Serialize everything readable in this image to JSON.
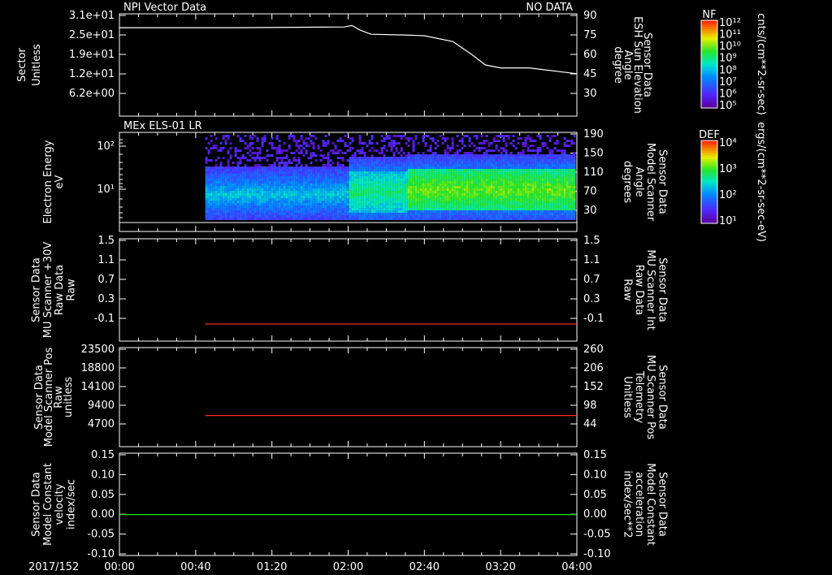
{
  "colors": {
    "axis": "#ffffff",
    "red": "#ff2a2a",
    "green": "#22dd22",
    "white": "#ffffff"
  },
  "time_axis": {
    "date_label": "2017/152",
    "ticks": [
      "00:00",
      "00:40",
      "01:20",
      "02:00",
      "02:40",
      "03:20",
      "04:00"
    ]
  },
  "colorbars": [
    {
      "label": "NF",
      "unit": "cnts/(cm**2-sr-sec)",
      "ticks": [
        "10¹²",
        "10¹¹",
        "10¹⁰",
        "10⁹",
        "10⁸",
        "10⁷",
        "10⁶",
        "10⁵"
      ]
    },
    {
      "label": "DEF",
      "unit": "ergs/(cm**2-sr-sec-eV)",
      "ticks": [
        "10⁴",
        "10³",
        "10²",
        "10¹"
      ]
    }
  ],
  "chart_data": [
    {
      "type": "line",
      "title": "NPI Vector Data",
      "status": "NO DATA",
      "ylabel_left": [
        "Sector",
        "Unitless"
      ],
      "left_ticks": [
        "3.1e+01",
        "2.5e+01",
        "1.9e+01",
        "1.2e+01",
        "6.2e+00"
      ],
      "ylabel_right": [
        "Sensor Data",
        "ESH Sun Elevation",
        "Angle",
        "degree"
      ],
      "right_ticks": [
        "90",
        "75",
        "60",
        "45",
        "30"
      ],
      "ylim": [
        20,
        90
      ],
      "series": [
        {
          "color": "#ffffff",
          "x": [
            0,
            60,
            118,
            122,
            126,
            132,
            150,
            160,
            175,
            185,
            192,
            200,
            215,
            240
          ],
          "y": [
            80.5,
            80.5,
            81,
            82,
            79,
            76,
            75.5,
            75,
            71,
            62,
            55,
            53,
            53,
            49
          ]
        }
      ]
    },
    {
      "type": "heatmap",
      "title": "MEx ELS-01 LR",
      "ylabel_left": [
        "Electron Energy",
        "eV"
      ],
      "left_ticks": [
        "10²",
        "10¹"
      ],
      "ylabel_right": [
        "Sensor Data",
        "Model Scanner",
        "Angle",
        "degrees"
      ],
      "right_ticks": [
        "190",
        "150",
        "110",
        "70",
        "30"
      ],
      "data_start_x": 45,
      "yscale": "log"
    },
    {
      "type": "line",
      "ylabel_left": [
        "Sensor Data",
        "MU Scanner +30V",
        "Raw Data",
        "Raw"
      ],
      "left_ticks": [
        "1.5",
        "1.1",
        "0.7",
        "0.3",
        "-0.1"
      ],
      "ylabel_right": [
        "Sensor Data",
        "MU Scanner Int",
        "Raw Data",
        "Raw"
      ],
      "right_ticks": [
        "1.5",
        "1.1",
        "0.7",
        "0.3",
        "-0.1"
      ],
      "ylim": [
        -0.3,
        1.5
      ],
      "series": [
        {
          "color": "#ff2a2a",
          "x": [
            45,
            240
          ],
          "y": [
            0,
            0
          ]
        }
      ]
    },
    {
      "type": "line",
      "ylabel_left": [
        "Sensor Data",
        "Model Scanner Pos",
        "Raw",
        "unitless"
      ],
      "left_ticks": [
        "23500",
        "18800",
        "14100",
        "9400",
        "4700"
      ],
      "ylabel_right": [
        "Sensor Data",
        "MU Scanner Pos",
        "Telemetry",
        "Unitless"
      ],
      "right_ticks": [
        "260",
        "206",
        "152",
        "98",
        "44"
      ],
      "ylim": [
        0,
        23500
      ],
      "series": [
        {
          "color": "#ff2a2a",
          "x": [
            45,
            240
          ],
          "y": [
            7400,
            7400
          ]
        }
      ]
    },
    {
      "type": "line",
      "ylabel_left": [
        "Sensor Data",
        "Model Constant",
        "velocity",
        "index/sec"
      ],
      "left_ticks": [
        "0.15",
        "0.10",
        "0.05",
        "0.00",
        "-0.05",
        "-0.10"
      ],
      "ylabel_right": [
        "Sensor Data",
        "Model Constant",
        "acceleration",
        "index/sec**2"
      ],
      "right_ticks": [
        "0.15",
        "0.10",
        "0.05",
        "0.00",
        "-0.05",
        "-0.10"
      ],
      "ylim": [
        -0.1,
        0.15
      ],
      "series": [
        {
          "color": "#22dd22",
          "x": [
            0,
            240
          ],
          "y": [
            0,
            0
          ]
        }
      ]
    }
  ]
}
